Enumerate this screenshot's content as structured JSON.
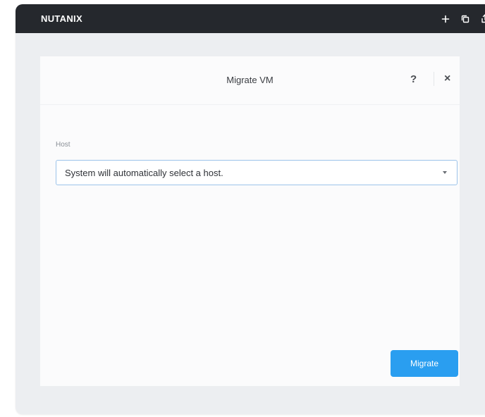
{
  "app": {
    "brand": "NUTANIX"
  },
  "titlebar": {
    "icons": [
      "plus-icon",
      "copy-icon",
      "share-icon"
    ]
  },
  "dialog": {
    "title": "Migrate VM",
    "help_label": "?",
    "close_label": "×",
    "host_field": {
      "label": "Host",
      "value": "System will automatically select a host."
    },
    "migrate_label": "Migrate"
  },
  "colors": {
    "titlebar": "#25282d",
    "accent": "#2a9ef0",
    "select_border": "#9cc3ea"
  }
}
